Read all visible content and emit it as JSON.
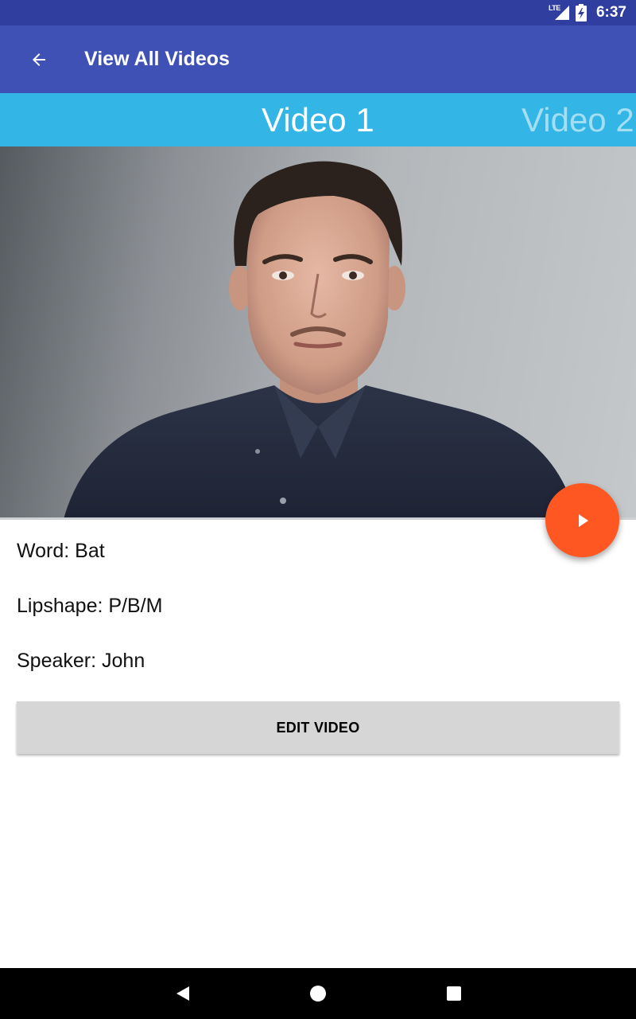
{
  "status_bar": {
    "network_label": "LTE",
    "time": "6:37",
    "icons": [
      "lte-signal-icon",
      "battery-charging-icon"
    ]
  },
  "app_bar": {
    "title": "View All Videos",
    "back_icon": "arrow-back-icon"
  },
  "tabs": [
    {
      "label": "Video 1",
      "selected": true
    },
    {
      "label": "Video 2",
      "selected": false
    }
  ],
  "video": {
    "play_icon": "play-icon"
  },
  "details": {
    "word": "Word: Bat",
    "lipshape": "Lipshape: P/B/M",
    "speaker": "Speaker: John"
  },
  "edit_button": {
    "label": "EDIT VIDEO"
  },
  "nav_bar": {
    "icons": [
      "back-triangle-icon",
      "home-circle-icon",
      "recents-square-icon"
    ]
  },
  "colors": {
    "status_bar": "#303f9f",
    "app_bar": "#3f51b5",
    "tab_strip": "#33b5e5",
    "fab": "#ff5722",
    "button": "#d6d6d6"
  }
}
